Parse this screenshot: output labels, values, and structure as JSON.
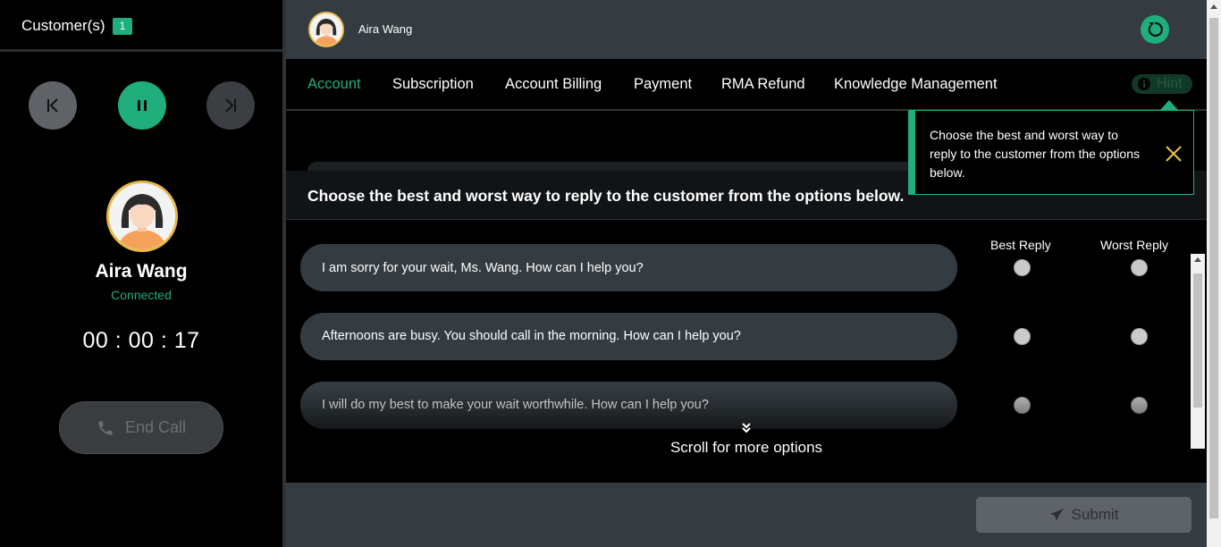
{
  "customers": {
    "title": "Customer(s)",
    "count": "1"
  },
  "caller": {
    "name": "Aira Wang",
    "status": "Connected",
    "timer": "00 : 00 : 17",
    "end_call_label": "End Call"
  },
  "topbar": {
    "name": "Aira Wang"
  },
  "tabs": [
    {
      "label": "Account",
      "active": true
    },
    {
      "label": "Subscription"
    },
    {
      "label": "Account Billing"
    },
    {
      "label": "Payment"
    },
    {
      "label": "RMA Refund"
    },
    {
      "label": "Knowledge Management"
    }
  ],
  "hint": {
    "button_label": "Hint",
    "popover_text": "Choose the best and worst way to reply to the customer from the options below."
  },
  "question": {
    "text": "Choose the best and worst way to reply to the customer from the options below.",
    "best_label": "Best Reply",
    "worst_label": "Worst Reply",
    "options": [
      "I am sorry for your wait, Ms. Wang. How can I help you?",
      "Afternoons are busy. You should call in the morning. How can I help you?",
      "I will do my best to make your wait worthwhile. How can I help you?"
    ],
    "scroll_hint": "Scroll for more options"
  },
  "footer": {
    "submit_label": "Submit"
  },
  "colors": {
    "accent": "#1fae7c",
    "panel": "#343c42",
    "avatar_ring": "#e8b94a"
  }
}
